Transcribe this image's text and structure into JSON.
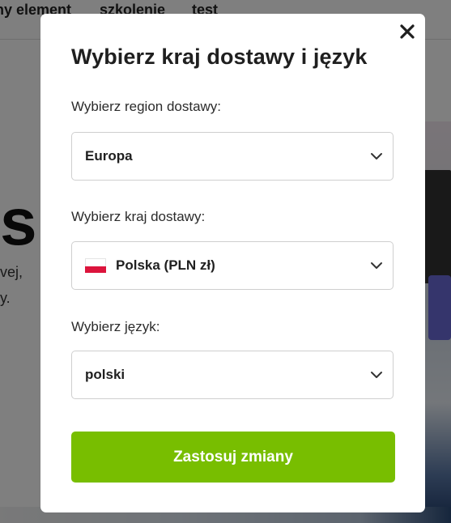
{
  "background": {
    "nav_items": [
      "ny element",
      "szkolenie",
      "test"
    ],
    "hero_letter": "s",
    "lines": [
      "vej,",
      "y."
    ]
  },
  "modal": {
    "title": "Wybierz kraj dostawy i język",
    "close_icon": "close-icon",
    "region": {
      "label": "Wybierz region dostawy:",
      "value": "Europa"
    },
    "country": {
      "label": "Wybierz kraj dostawy:",
      "value": "Polska (PLN zł)",
      "flag_icon": "poland-flag-icon"
    },
    "language": {
      "label": "Wybierz język:",
      "value": "polski"
    },
    "apply_label": "Zastosuj zmiany"
  },
  "colors": {
    "accent": "#78be00",
    "overlay": "rgba(0,0,0,0.5)",
    "flag_red": "#dc143c"
  }
}
